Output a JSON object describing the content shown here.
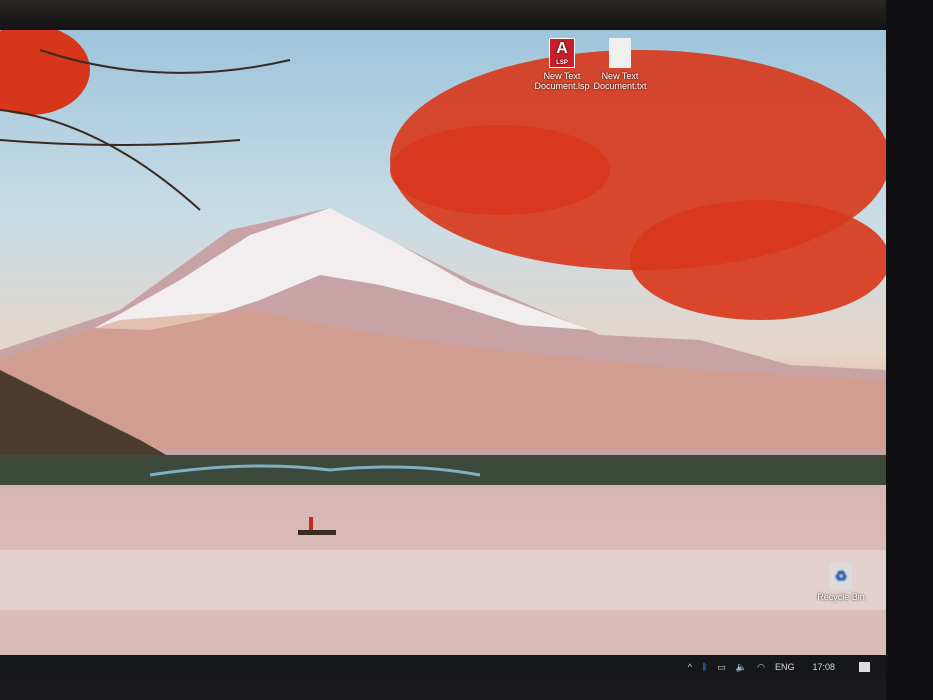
{
  "desktop": {
    "icons": [
      {
        "label": "New Text Document.lsp",
        "badge": "LSP",
        "glyph": "A",
        "icon": "autocad-lsp-file-icon"
      },
      {
        "label": "New Text Document.txt",
        "icon": "text-file-icon"
      },
      {
        "label": "Recycle Bin",
        "icon": "recycle-bin-icon"
      }
    ]
  },
  "taskbar": {
    "language": "ENG",
    "time": "17:08",
    "tray_icons": [
      "chevron-up-icon",
      "bluetooth-icon",
      "battery-icon",
      "volume-icon",
      "wifi-icon",
      "notification-icon"
    ]
  },
  "colors": {
    "taskbar": "#15171b",
    "accent_blue": "#1e6fe0",
    "leaves": "#d8361a"
  }
}
